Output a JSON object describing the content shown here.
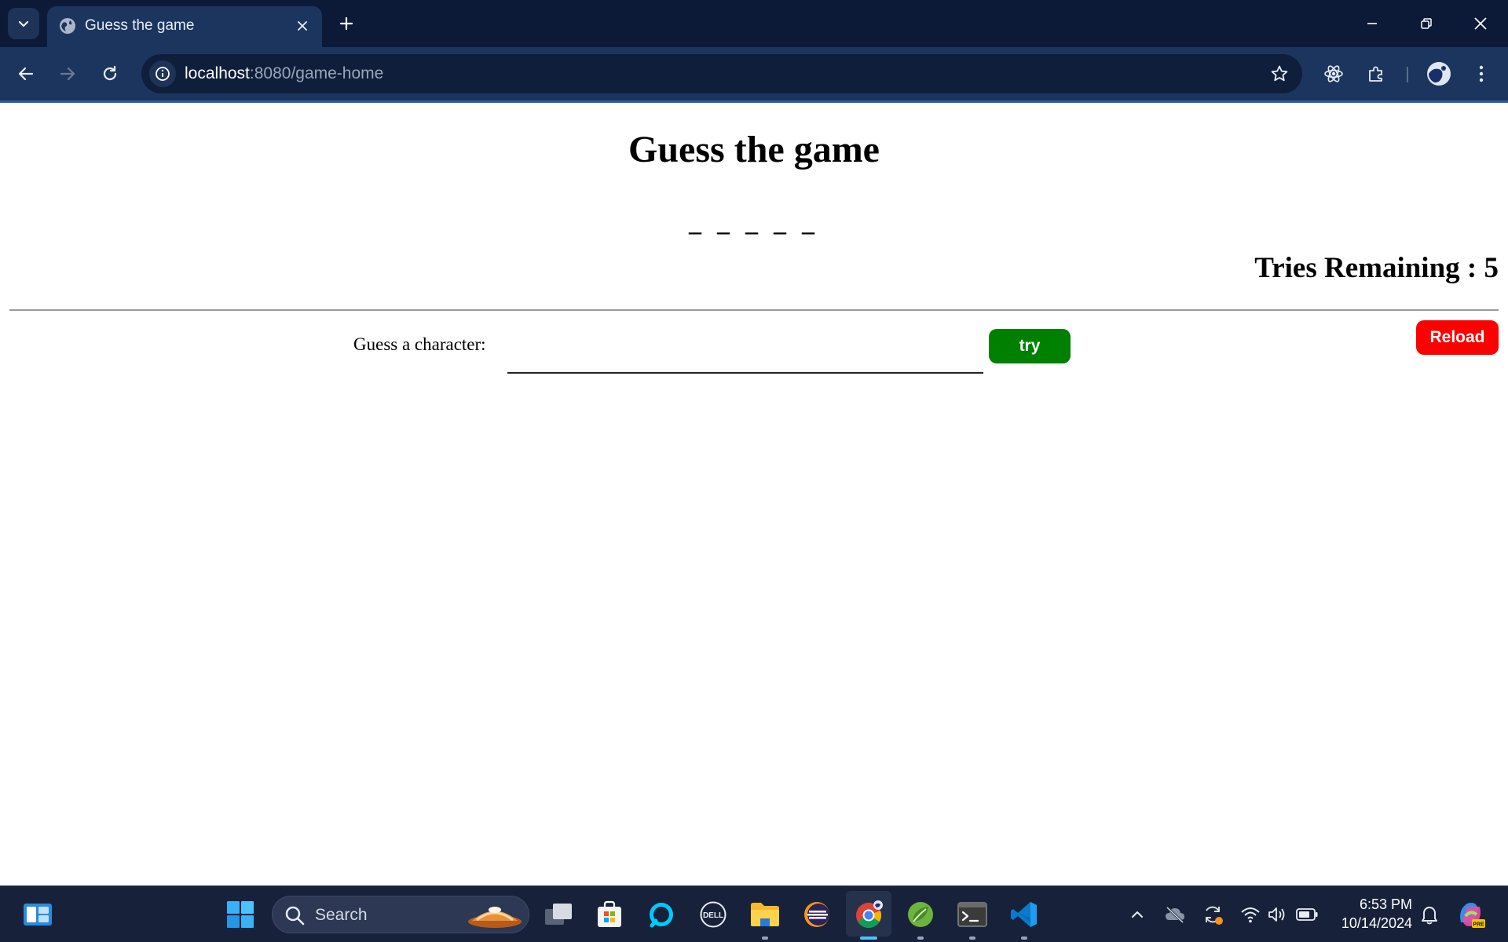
{
  "browser": {
    "tab": {
      "title": "Guess the game"
    },
    "address_bar": {
      "host": "localhost",
      "path": ":8080/game-home"
    }
  },
  "page": {
    "title": "Guess the game",
    "word_blanks": "_ _ _ _ _",
    "tries_remaining": "Tries Remaining : 5",
    "guess_label": "Guess a character:",
    "guess_input_value": "",
    "try_label": "try",
    "reload_label": "Reload"
  },
  "colors": {
    "try_button": "#008000",
    "reload_button": "#ff0000",
    "titlebar": "#0c1a38",
    "toolbar": "#1c355f",
    "taskbar": "#17223a"
  },
  "taskbar": {
    "search_placeholder": "Search",
    "time": "6:53 PM",
    "date": "10/14/2024",
    "pinned_apps": [
      "widgets-icon",
      "windows-start-icon",
      "task-view-icon",
      "microsoft-store-icon",
      "alexa-icon",
      "dell-icon",
      "file-explorer-icon",
      "eclipse-icon",
      "chrome-icon",
      "spring-tools-icon",
      "terminal-icon",
      "vscode-icon"
    ]
  }
}
